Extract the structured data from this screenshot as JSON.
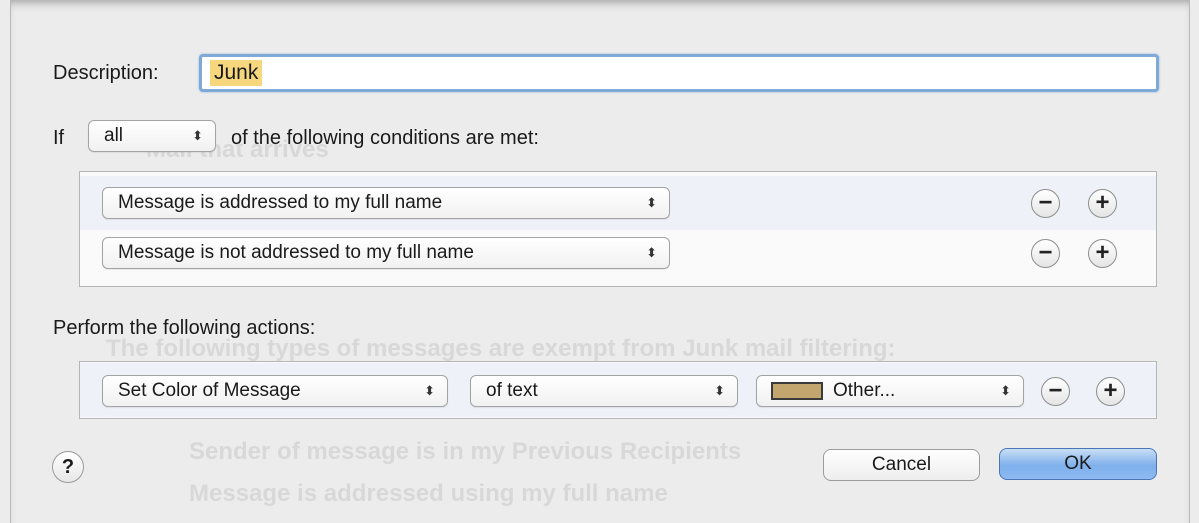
{
  "description": {
    "label": "Description:",
    "value": "Junk"
  },
  "conditions": {
    "if_label": "If",
    "match_mode": "all",
    "suffix": "of the following conditions are met:",
    "rows": [
      {
        "condition": "Message is addressed to my full name"
      },
      {
        "condition": "Message is not addressed to my full name"
      }
    ]
  },
  "actions": {
    "label": "Perform the following actions:",
    "rows": [
      {
        "action": "Set Color of Message",
        "target": "of text",
        "color_option": "Other...",
        "color_swatch": "#c2a66d"
      }
    ]
  },
  "buttons": {
    "help": "?",
    "cancel": "Cancel",
    "ok": "OK",
    "remove": "−",
    "add": "+"
  },
  "background_text": [
    "Mail that arrives",
    "The following types of messages are exempt from Junk mail filtering:",
    "Sender of message is in my Previous Recipients",
    "Message is addressed using my full name"
  ],
  "colors": {
    "accent": "#7fb0ec",
    "selection": "#f7d77e"
  }
}
